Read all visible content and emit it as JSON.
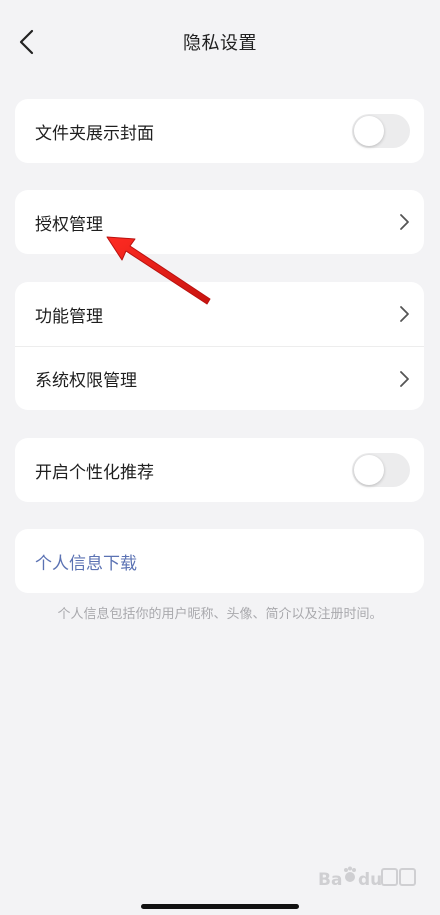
{
  "nav": {
    "title": "隐私设置",
    "back_icon": "chevron-left-icon"
  },
  "settings": {
    "folder_cover": {
      "label": "文件夹展示封面",
      "toggle_on": false
    },
    "auth_management": {
      "label": "授权管理",
      "icon": "chevron-right-icon"
    },
    "feature_management": {
      "label": "功能管理",
      "icon": "chevron-right-icon"
    },
    "system_permission": {
      "label": "系统权限管理",
      "icon": "chevron-right-icon"
    },
    "personalized_recommend": {
      "label": "开启个性化推荐",
      "toggle_on": false
    },
    "personal_info_download": {
      "label": "个人信息下载"
    },
    "hint_text": "个人信息包括你的用户昵称、头像、简介以及注册时间。"
  },
  "annotation": {
    "arrow_color": "#e0201b",
    "target": "auth_management"
  },
  "watermark": {
    "text": "Baidu经验"
  },
  "colors": {
    "background": "#f3f3f5",
    "card": "#ffffff",
    "link": "#5b72b3",
    "toggle_off": "#ececed",
    "hint": "#a9a9ad"
  }
}
